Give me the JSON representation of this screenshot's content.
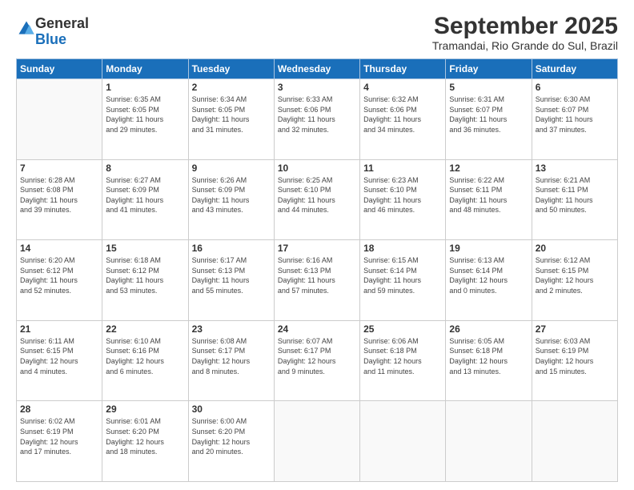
{
  "header": {
    "logo_general": "General",
    "logo_blue": "Blue",
    "title": "September 2025",
    "subtitle": "Tramandai, Rio Grande do Sul, Brazil"
  },
  "weekdays": [
    "Sunday",
    "Monday",
    "Tuesday",
    "Wednesday",
    "Thursday",
    "Friday",
    "Saturday"
  ],
  "weeks": [
    [
      {
        "day": "",
        "info": ""
      },
      {
        "day": "1",
        "info": "Sunrise: 6:35 AM\nSunset: 6:05 PM\nDaylight: 11 hours\nand 29 minutes."
      },
      {
        "day": "2",
        "info": "Sunrise: 6:34 AM\nSunset: 6:05 PM\nDaylight: 11 hours\nand 31 minutes."
      },
      {
        "day": "3",
        "info": "Sunrise: 6:33 AM\nSunset: 6:06 PM\nDaylight: 11 hours\nand 32 minutes."
      },
      {
        "day": "4",
        "info": "Sunrise: 6:32 AM\nSunset: 6:06 PM\nDaylight: 11 hours\nand 34 minutes."
      },
      {
        "day": "5",
        "info": "Sunrise: 6:31 AM\nSunset: 6:07 PM\nDaylight: 11 hours\nand 36 minutes."
      },
      {
        "day": "6",
        "info": "Sunrise: 6:30 AM\nSunset: 6:07 PM\nDaylight: 11 hours\nand 37 minutes."
      }
    ],
    [
      {
        "day": "7",
        "info": "Sunrise: 6:28 AM\nSunset: 6:08 PM\nDaylight: 11 hours\nand 39 minutes."
      },
      {
        "day": "8",
        "info": "Sunrise: 6:27 AM\nSunset: 6:09 PM\nDaylight: 11 hours\nand 41 minutes."
      },
      {
        "day": "9",
        "info": "Sunrise: 6:26 AM\nSunset: 6:09 PM\nDaylight: 11 hours\nand 43 minutes."
      },
      {
        "day": "10",
        "info": "Sunrise: 6:25 AM\nSunset: 6:10 PM\nDaylight: 11 hours\nand 44 minutes."
      },
      {
        "day": "11",
        "info": "Sunrise: 6:23 AM\nSunset: 6:10 PM\nDaylight: 11 hours\nand 46 minutes."
      },
      {
        "day": "12",
        "info": "Sunrise: 6:22 AM\nSunset: 6:11 PM\nDaylight: 11 hours\nand 48 minutes."
      },
      {
        "day": "13",
        "info": "Sunrise: 6:21 AM\nSunset: 6:11 PM\nDaylight: 11 hours\nand 50 minutes."
      }
    ],
    [
      {
        "day": "14",
        "info": "Sunrise: 6:20 AM\nSunset: 6:12 PM\nDaylight: 11 hours\nand 52 minutes."
      },
      {
        "day": "15",
        "info": "Sunrise: 6:18 AM\nSunset: 6:12 PM\nDaylight: 11 hours\nand 53 minutes."
      },
      {
        "day": "16",
        "info": "Sunrise: 6:17 AM\nSunset: 6:13 PM\nDaylight: 11 hours\nand 55 minutes."
      },
      {
        "day": "17",
        "info": "Sunrise: 6:16 AM\nSunset: 6:13 PM\nDaylight: 11 hours\nand 57 minutes."
      },
      {
        "day": "18",
        "info": "Sunrise: 6:15 AM\nSunset: 6:14 PM\nDaylight: 11 hours\nand 59 minutes."
      },
      {
        "day": "19",
        "info": "Sunrise: 6:13 AM\nSunset: 6:14 PM\nDaylight: 12 hours\nand 0 minutes."
      },
      {
        "day": "20",
        "info": "Sunrise: 6:12 AM\nSunset: 6:15 PM\nDaylight: 12 hours\nand 2 minutes."
      }
    ],
    [
      {
        "day": "21",
        "info": "Sunrise: 6:11 AM\nSunset: 6:15 PM\nDaylight: 12 hours\nand 4 minutes."
      },
      {
        "day": "22",
        "info": "Sunrise: 6:10 AM\nSunset: 6:16 PM\nDaylight: 12 hours\nand 6 minutes."
      },
      {
        "day": "23",
        "info": "Sunrise: 6:08 AM\nSunset: 6:17 PM\nDaylight: 12 hours\nand 8 minutes."
      },
      {
        "day": "24",
        "info": "Sunrise: 6:07 AM\nSunset: 6:17 PM\nDaylight: 12 hours\nand 9 minutes."
      },
      {
        "day": "25",
        "info": "Sunrise: 6:06 AM\nSunset: 6:18 PM\nDaylight: 12 hours\nand 11 minutes."
      },
      {
        "day": "26",
        "info": "Sunrise: 6:05 AM\nSunset: 6:18 PM\nDaylight: 12 hours\nand 13 minutes."
      },
      {
        "day": "27",
        "info": "Sunrise: 6:03 AM\nSunset: 6:19 PM\nDaylight: 12 hours\nand 15 minutes."
      }
    ],
    [
      {
        "day": "28",
        "info": "Sunrise: 6:02 AM\nSunset: 6:19 PM\nDaylight: 12 hours\nand 17 minutes."
      },
      {
        "day": "29",
        "info": "Sunrise: 6:01 AM\nSunset: 6:20 PM\nDaylight: 12 hours\nand 18 minutes."
      },
      {
        "day": "30",
        "info": "Sunrise: 6:00 AM\nSunset: 6:20 PM\nDaylight: 12 hours\nand 20 minutes."
      },
      {
        "day": "",
        "info": ""
      },
      {
        "day": "",
        "info": ""
      },
      {
        "day": "",
        "info": ""
      },
      {
        "day": "",
        "info": ""
      }
    ]
  ]
}
